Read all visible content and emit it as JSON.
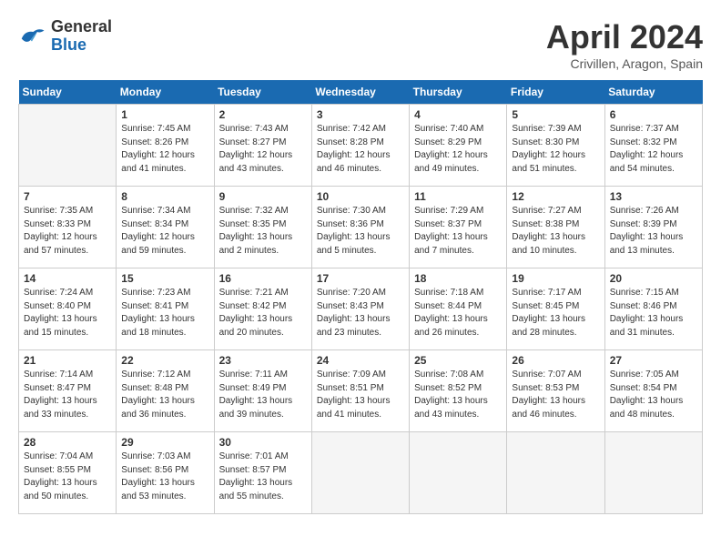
{
  "header": {
    "logo_general": "General",
    "logo_blue": "Blue",
    "title": "April 2024",
    "subtitle": "Crivillen, Aragon, Spain"
  },
  "weekdays": [
    "Sunday",
    "Monday",
    "Tuesday",
    "Wednesday",
    "Thursday",
    "Friday",
    "Saturday"
  ],
  "weeks": [
    [
      {
        "day": "",
        "info": ""
      },
      {
        "day": "1",
        "info": "Sunrise: 7:45 AM\nSunset: 8:26 PM\nDaylight: 12 hours\nand 41 minutes."
      },
      {
        "day": "2",
        "info": "Sunrise: 7:43 AM\nSunset: 8:27 PM\nDaylight: 12 hours\nand 43 minutes."
      },
      {
        "day": "3",
        "info": "Sunrise: 7:42 AM\nSunset: 8:28 PM\nDaylight: 12 hours\nand 46 minutes."
      },
      {
        "day": "4",
        "info": "Sunrise: 7:40 AM\nSunset: 8:29 PM\nDaylight: 12 hours\nand 49 minutes."
      },
      {
        "day": "5",
        "info": "Sunrise: 7:39 AM\nSunset: 8:30 PM\nDaylight: 12 hours\nand 51 minutes."
      },
      {
        "day": "6",
        "info": "Sunrise: 7:37 AM\nSunset: 8:32 PM\nDaylight: 12 hours\nand 54 minutes."
      }
    ],
    [
      {
        "day": "7",
        "info": "Sunrise: 7:35 AM\nSunset: 8:33 PM\nDaylight: 12 hours\nand 57 minutes."
      },
      {
        "day": "8",
        "info": "Sunrise: 7:34 AM\nSunset: 8:34 PM\nDaylight: 12 hours\nand 59 minutes."
      },
      {
        "day": "9",
        "info": "Sunrise: 7:32 AM\nSunset: 8:35 PM\nDaylight: 13 hours\nand 2 minutes."
      },
      {
        "day": "10",
        "info": "Sunrise: 7:30 AM\nSunset: 8:36 PM\nDaylight: 13 hours\nand 5 minutes."
      },
      {
        "day": "11",
        "info": "Sunrise: 7:29 AM\nSunset: 8:37 PM\nDaylight: 13 hours\nand 7 minutes."
      },
      {
        "day": "12",
        "info": "Sunrise: 7:27 AM\nSunset: 8:38 PM\nDaylight: 13 hours\nand 10 minutes."
      },
      {
        "day": "13",
        "info": "Sunrise: 7:26 AM\nSunset: 8:39 PM\nDaylight: 13 hours\nand 13 minutes."
      }
    ],
    [
      {
        "day": "14",
        "info": "Sunrise: 7:24 AM\nSunset: 8:40 PM\nDaylight: 13 hours\nand 15 minutes."
      },
      {
        "day": "15",
        "info": "Sunrise: 7:23 AM\nSunset: 8:41 PM\nDaylight: 13 hours\nand 18 minutes."
      },
      {
        "day": "16",
        "info": "Sunrise: 7:21 AM\nSunset: 8:42 PM\nDaylight: 13 hours\nand 20 minutes."
      },
      {
        "day": "17",
        "info": "Sunrise: 7:20 AM\nSunset: 8:43 PM\nDaylight: 13 hours\nand 23 minutes."
      },
      {
        "day": "18",
        "info": "Sunrise: 7:18 AM\nSunset: 8:44 PM\nDaylight: 13 hours\nand 26 minutes."
      },
      {
        "day": "19",
        "info": "Sunrise: 7:17 AM\nSunset: 8:45 PM\nDaylight: 13 hours\nand 28 minutes."
      },
      {
        "day": "20",
        "info": "Sunrise: 7:15 AM\nSunset: 8:46 PM\nDaylight: 13 hours\nand 31 minutes."
      }
    ],
    [
      {
        "day": "21",
        "info": "Sunrise: 7:14 AM\nSunset: 8:47 PM\nDaylight: 13 hours\nand 33 minutes."
      },
      {
        "day": "22",
        "info": "Sunrise: 7:12 AM\nSunset: 8:48 PM\nDaylight: 13 hours\nand 36 minutes."
      },
      {
        "day": "23",
        "info": "Sunrise: 7:11 AM\nSunset: 8:49 PM\nDaylight: 13 hours\nand 39 minutes."
      },
      {
        "day": "24",
        "info": "Sunrise: 7:09 AM\nSunset: 8:51 PM\nDaylight: 13 hours\nand 41 minutes."
      },
      {
        "day": "25",
        "info": "Sunrise: 7:08 AM\nSunset: 8:52 PM\nDaylight: 13 hours\nand 43 minutes."
      },
      {
        "day": "26",
        "info": "Sunrise: 7:07 AM\nSunset: 8:53 PM\nDaylight: 13 hours\nand 46 minutes."
      },
      {
        "day": "27",
        "info": "Sunrise: 7:05 AM\nSunset: 8:54 PM\nDaylight: 13 hours\nand 48 minutes."
      }
    ],
    [
      {
        "day": "28",
        "info": "Sunrise: 7:04 AM\nSunset: 8:55 PM\nDaylight: 13 hours\nand 50 minutes."
      },
      {
        "day": "29",
        "info": "Sunrise: 7:03 AM\nSunset: 8:56 PM\nDaylight: 13 hours\nand 53 minutes."
      },
      {
        "day": "30",
        "info": "Sunrise: 7:01 AM\nSunset: 8:57 PM\nDaylight: 13 hours\nand 55 minutes."
      },
      {
        "day": "",
        "info": ""
      },
      {
        "day": "",
        "info": ""
      },
      {
        "day": "",
        "info": ""
      },
      {
        "day": "",
        "info": ""
      }
    ]
  ]
}
